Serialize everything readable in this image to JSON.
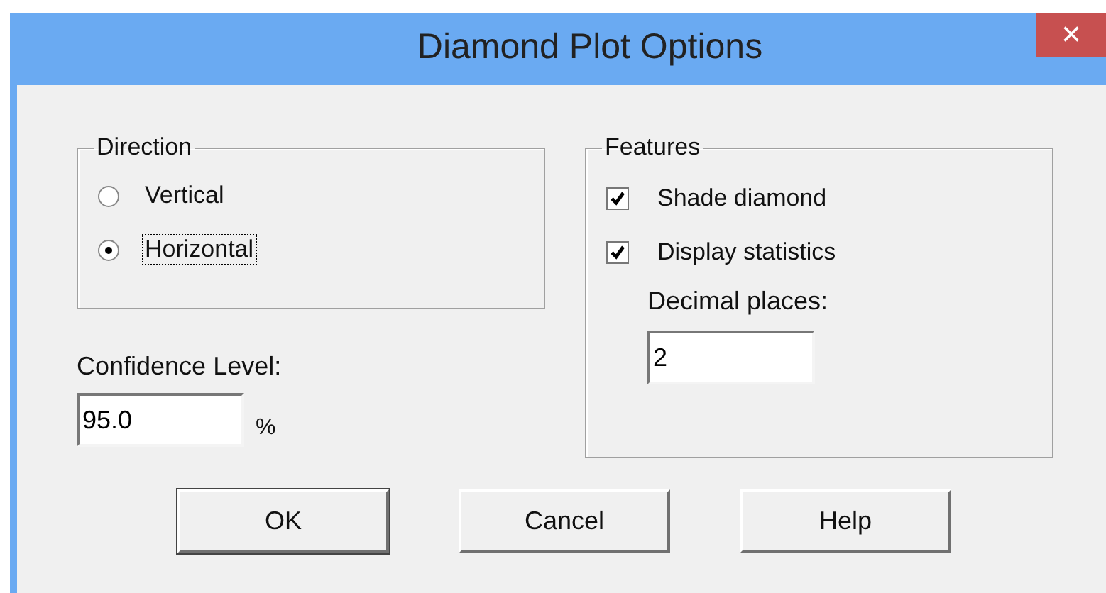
{
  "window": {
    "title": "Diamond Plot Options",
    "close": "×"
  },
  "direction": {
    "label": "Direction",
    "options": [
      {
        "label": "Vertical",
        "selected": false,
        "focused": false
      },
      {
        "label": "Horizontal",
        "selected": true,
        "focused": true
      }
    ]
  },
  "confidence": {
    "label": "Confidence Level:",
    "value": "95.0",
    "unit": "%"
  },
  "features": {
    "label": "Features",
    "checkboxes": [
      {
        "label": "Shade diamond",
        "checked": true
      },
      {
        "label": "Display statistics",
        "checked": true
      }
    ],
    "decimal": {
      "label": "Decimal places:",
      "value": "2"
    }
  },
  "buttons": [
    {
      "label": "OK",
      "default": true
    },
    {
      "label": "Cancel",
      "default": false
    },
    {
      "label": "Help",
      "default": false
    }
  ]
}
